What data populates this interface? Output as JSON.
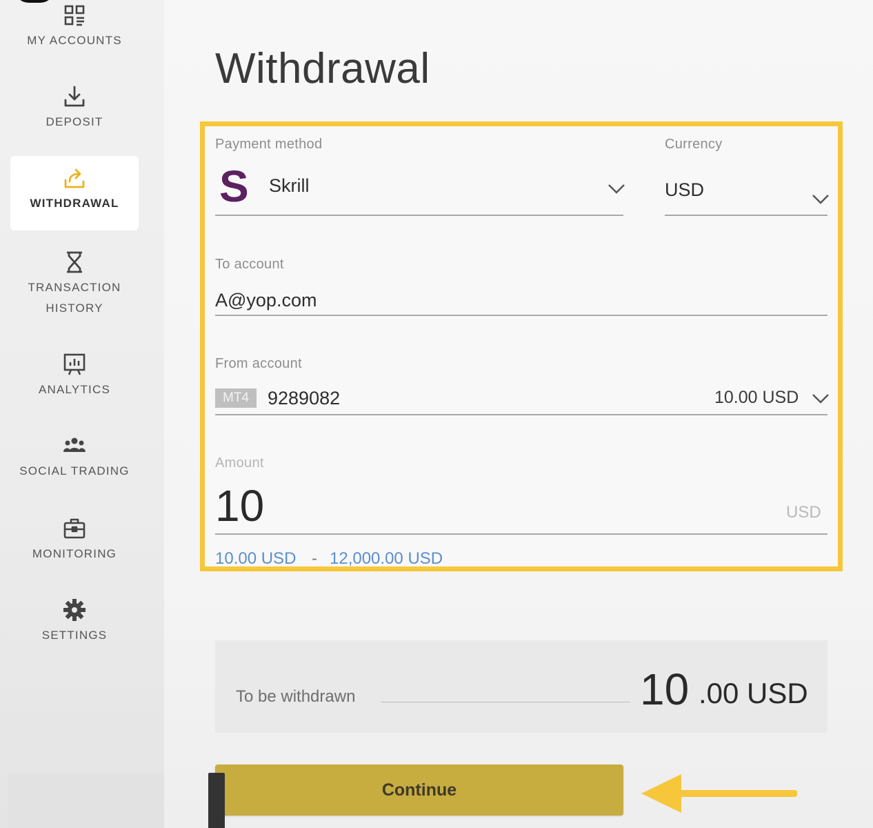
{
  "sidebar": {
    "items": [
      {
        "label": "MY ACCOUNTS",
        "icon": "accounts-grid-icon"
      },
      {
        "label": "DEPOSIT",
        "icon": "download-icon"
      },
      {
        "label": "WITHDRAWAL",
        "icon": "upload-share-icon",
        "active": true
      },
      {
        "label": "TRANSACTION\nHISTORY",
        "icon": "hourglass-icon"
      },
      {
        "label": "ANALYTICS",
        "icon": "chart-board-icon"
      },
      {
        "label": "SOCIAL TRADING",
        "icon": "people-icon"
      },
      {
        "label": "MONITORING",
        "icon": "briefcase-icon"
      },
      {
        "label": "SETTINGS",
        "icon": "gear-icon"
      }
    ]
  },
  "page": {
    "title": "Withdrawal"
  },
  "form": {
    "payment_method": {
      "label": "Payment method",
      "value": "Skrill",
      "logo_letter": "S"
    },
    "currency": {
      "label": "Currency",
      "value": "USD"
    },
    "to_account": {
      "label": "To account",
      "value": "A@yop.com"
    },
    "from_account": {
      "label": "From account",
      "badge": "MT4",
      "number": "9289082",
      "balance": "10.00 USD"
    },
    "amount": {
      "label": "Amount",
      "value": "10",
      "unit": "USD",
      "min": "10.00 USD",
      "separator": "-",
      "max": "12,000.00 USD"
    }
  },
  "summary": {
    "label": "To be withdrawn",
    "amount_int": "10",
    "amount_rest": ".00 USD"
  },
  "actions": {
    "continue_label": "Continue"
  },
  "colors": {
    "highlight": "#f6c73b",
    "button": "#c7ac40",
    "skrill": "#5b2161",
    "link": "#5a8fd0"
  }
}
